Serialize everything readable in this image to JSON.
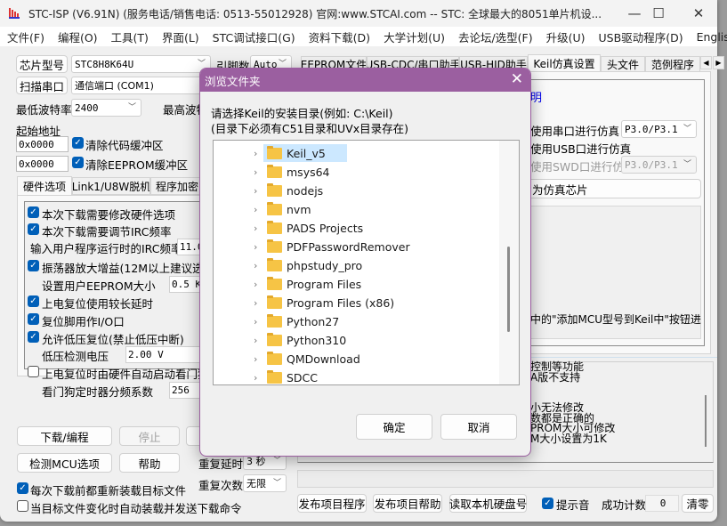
{
  "window": {
    "title": "STC-ISP (V6.91N) (服务电话/销售电话: 0513-55012928) 官网:www.STCAI.com  -- STC: 全球最大的8051单片机设...",
    "minimize": "—",
    "maximize": "☐",
    "close": "✕"
  },
  "menu": [
    "文件(F)",
    "编程(O)",
    "工具(T)",
    "界面(L)",
    "STC调试接口(G)",
    "资料下载(D)",
    "大学计划(U)",
    "去论坛/选型(F)",
    "升级(U)",
    "USB驱动程序(D)",
    "English"
  ],
  "left": {
    "chip_btn": "芯片型号",
    "chip_value": "STC8H8K64U",
    "pins_label": "引脚数",
    "pins_value": "Auto",
    "scan_btn": "扫描串口",
    "port_value": "通信端口 (COM1)",
    "min_baud_label": "最低波特率",
    "min_baud_value": "2400",
    "max_baud_label": "最高波特",
    "start_addr_label": "起始地址",
    "addr1": "0x0000",
    "clear_code": "清除代码缓冲区",
    "addr2": "0x0000",
    "clear_eeprom": "清除EEPROM缓冲区",
    "tabs": [
      "硬件选项",
      "Link1/U8W脱机",
      "程序加密"
    ],
    "options": [
      {
        "label": "本次下载需要修改硬件选项",
        "checked": true
      },
      {
        "label": "本次下载需要调节IRC频率",
        "checked": true
      },
      {
        "label": "输入用户程序运行时的IRC频率",
        "value": "11.0"
      },
      {
        "label": "振荡器放大增益(12M以上建议选择",
        "checked": true
      },
      {
        "label": "设置用户EEPROM大小",
        "value": "0.5 K"
      },
      {
        "label": "上电复位使用较长延时",
        "checked": true
      },
      {
        "label": "复位脚用作I/O口",
        "checked": true
      },
      {
        "label": "允许低压复位(禁止低压中断)",
        "checked": true
      },
      {
        "label": "低压检测电压",
        "value": "2.00 V"
      },
      {
        "label": "上电复位时由硬件自动启动看门狗",
        "checked": false
      },
      {
        "label": "看门狗定时器分频系数",
        "value": "256"
      }
    ],
    "download_btn": "下载/编程",
    "stop_btn": "停止",
    "detect_btn": "检测MCU选项",
    "help_btn": "帮助",
    "repeat_delay_label": "重复延时",
    "repeat_delay_value": "3 秒",
    "repeat_count_label": "重复次数",
    "repeat_count_value": "无限",
    "reload_label": "每次下载前都重新装载目标文件",
    "reload_checked": true,
    "auto_label": "当目标文件变化时自动装载并发送下载命令",
    "auto_checked": false
  },
  "right": {
    "tabs": [
      "EEPROM文件",
      "USB-CDC/串口助手",
      "USB-HID助手",
      "Keil仿真设置",
      "头文件",
      "范例程序"
    ],
    "active_tab": "Keil仿真设置",
    "link_fragment": "明",
    "serial_sim": "使用串口进行仿真",
    "serial_value": "P3.0/P3.1",
    "usb_sim": "使用USB口进行仿真",
    "swd_sim": "使用SWD口进行仿真",
    "swd_value": "P3.0/P3.1",
    "set_chip_fragment": "为仿真芯片",
    "note_fragment": "中的\"添加MCU型号到Keil中\"按钮进",
    "info_lines": [
      "控制等功能",
      "A版不支持",
      "",
      "",
      "小无法修改",
      "数都是正确的",
      "PROM大小可修改",
      "M大小设置为1K"
    ],
    "publish_prog": "发布项目程序",
    "publish_help": "发布项目帮助",
    "read_disk": "读取本机硬盘号",
    "sound_label": "提示音",
    "sound_checked": true,
    "success_label": "成功计数",
    "success_value": "0",
    "clear_btn": "清零"
  },
  "dialog": {
    "title": "浏览文件夹",
    "line1": "请选择Keil的安装目录(例如: C:\\Keil)",
    "line2": "(目录下必须有C51目录和UVx目录存在)",
    "folders": [
      "Keil_v5",
      "msys64",
      "nodejs",
      "nvm",
      "PADS Projects",
      "PDFPasswordRemover",
      "phpstudy_pro",
      "Program Files",
      "Program Files (x86)",
      "Python27",
      "Python310",
      "QMDownload",
      "SDCC"
    ],
    "selected": "Keil_v5",
    "scroll_fraction": 0.35,
    "ok": "确定",
    "cancel": "取消",
    "accent": "#9b5fa0"
  }
}
